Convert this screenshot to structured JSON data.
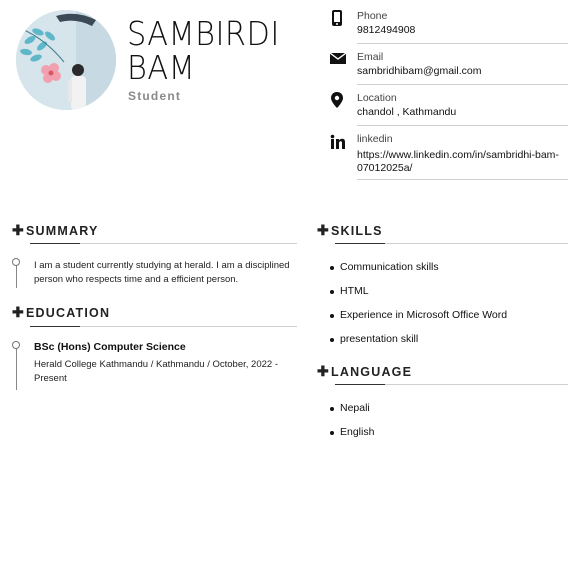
{
  "header": {
    "name_line1": "SAMBIRDI",
    "name_line2": "BAM",
    "role": "Student"
  },
  "contact": {
    "phone": {
      "label": "Phone",
      "value": "9812494908",
      "icon": "phone-icon"
    },
    "email": {
      "label": "Email",
      "value": "sambridhibam@gmail.com",
      "icon": "envelope-icon"
    },
    "location": {
      "label": "Location",
      "value": "chandol ,  Kathmandu",
      "icon": "map-pin-icon"
    },
    "linkedin": {
      "label": "linkedin",
      "value": "https://www.linkedin.com/in/sambridhi-bam-07012025a/",
      "icon": "linkedin-icon"
    }
  },
  "summary": {
    "heading": "SUMMARY",
    "text": "I am a student currently studying at herald. I am a disciplined person who respects time and a efficient person."
  },
  "education": {
    "heading": "EDUCATION",
    "items": [
      {
        "title": "BSc (Hons) Computer Science",
        "detail": "Herald College Kathmandu / Kathmandu / October, 2022 - Present"
      }
    ]
  },
  "skills": {
    "heading": "SKILLS",
    "items": [
      "Communication skills",
      "HTML",
      "Experience in Microsoft Office Word",
      "presentation skill"
    ]
  },
  "language": {
    "heading": "LANGUAGE",
    "items": [
      "Nepali",
      "English"
    ]
  }
}
